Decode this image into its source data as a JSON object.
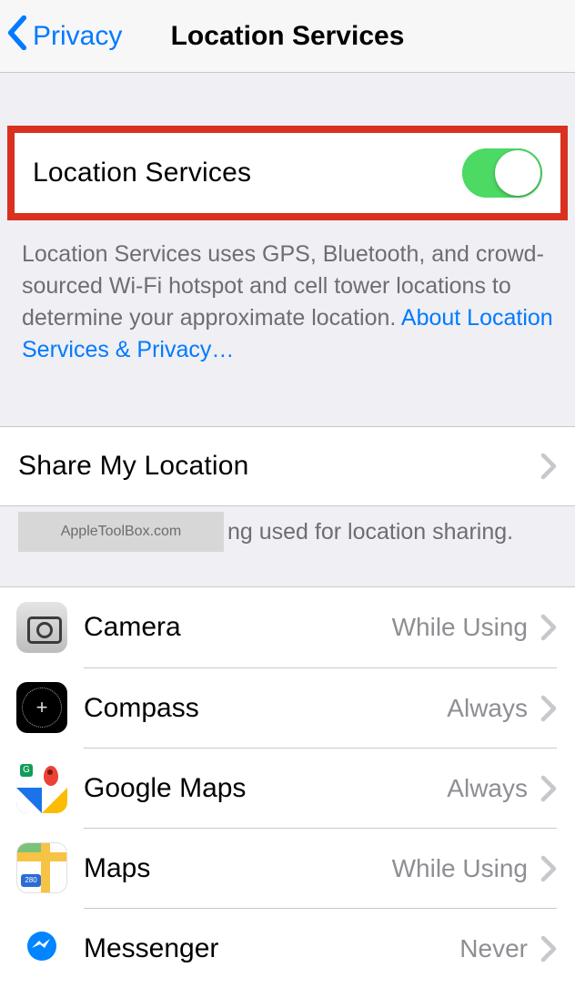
{
  "nav": {
    "back_label": "Privacy",
    "title": "Location Services"
  },
  "toggle": {
    "label": "Location Services",
    "on": true
  },
  "description": {
    "text": "Location Services uses GPS, Bluetooth, and crowd-sourced Wi-Fi hotspot and cell tower locations to determine your approximate location. ",
    "link": "About Location Services & Privacy…"
  },
  "share": {
    "label": "Share My Location",
    "footer_fragment": "ng used for location sharing."
  },
  "watermark": "AppleToolBox.com",
  "apps": [
    {
      "name": "Camera",
      "status": "While Using",
      "icon": "camera"
    },
    {
      "name": "Compass",
      "status": "Always",
      "icon": "compass"
    },
    {
      "name": "Google Maps",
      "status": "Always",
      "icon": "gmaps"
    },
    {
      "name": "Maps",
      "status": "While Using",
      "icon": "maps"
    },
    {
      "name": "Messenger",
      "status": "Never",
      "icon": "messenger"
    }
  ]
}
